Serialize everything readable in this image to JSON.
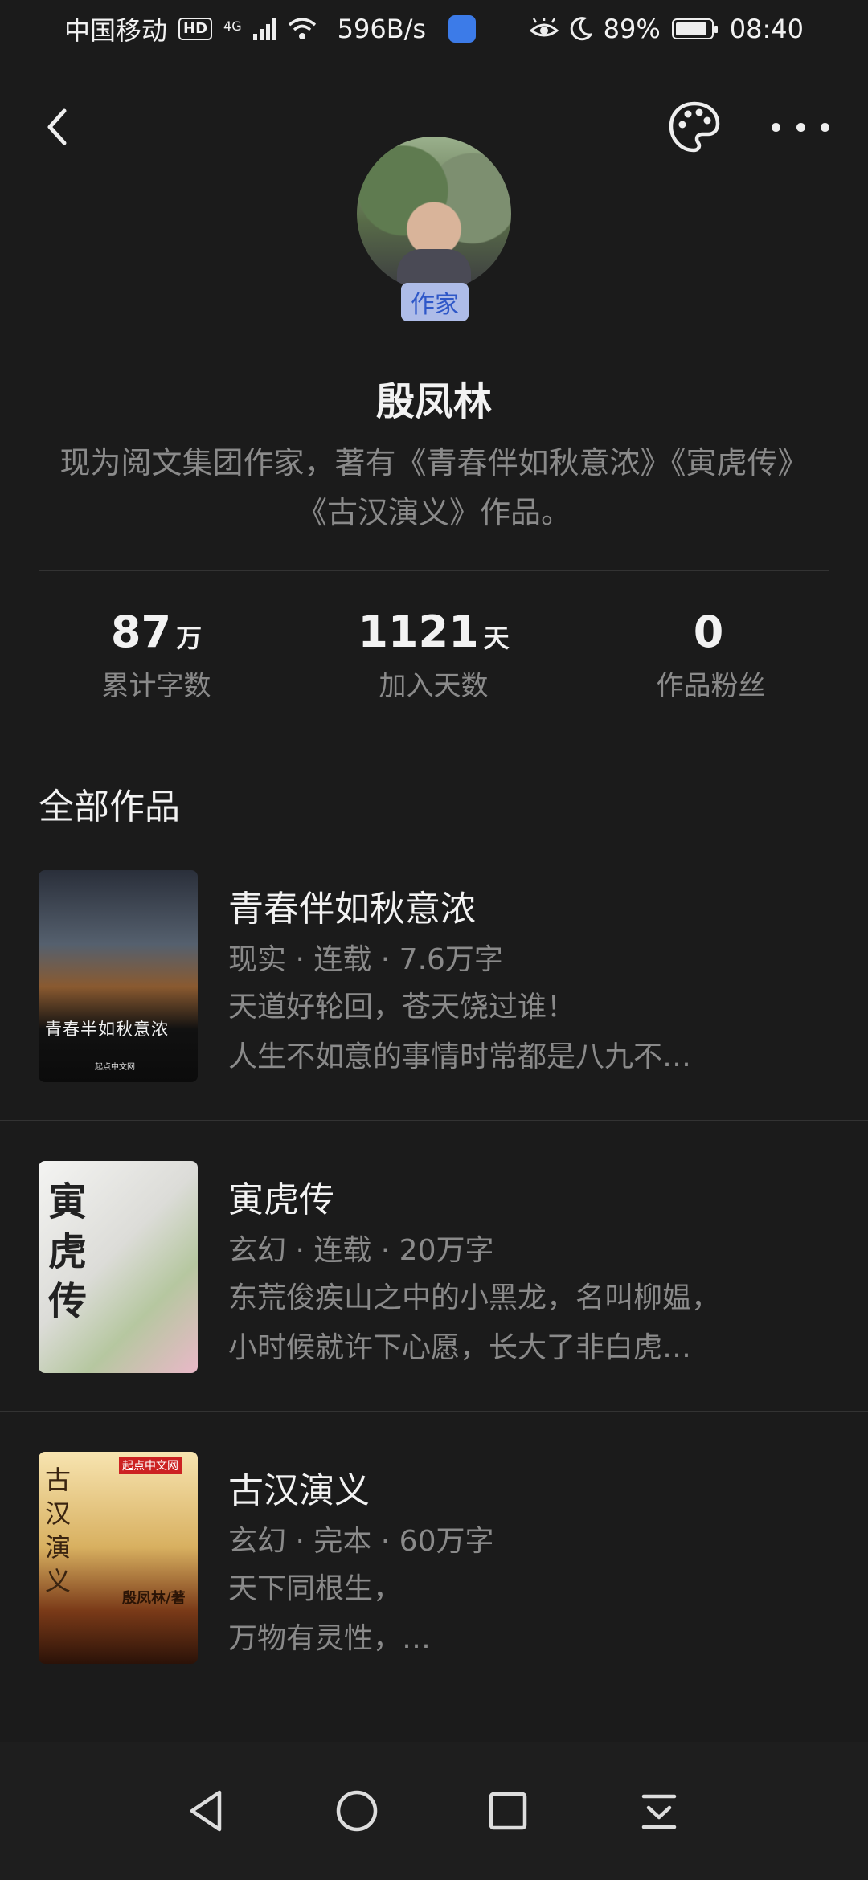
{
  "status_bar": {
    "carrier": "中国移动",
    "hd": "HD",
    "network": "4G",
    "speed": "596B/s",
    "battery": "89%",
    "time": "08:40"
  },
  "header": {
    "back_icon": "chevron-left-icon",
    "palette_icon": "palette-icon",
    "more_icon": "more-dots-icon"
  },
  "profile": {
    "badge": "作家",
    "name": "殷凤林",
    "bio": "现为阅文集团作家，著有《青春伴如秋意浓》《寅虎传》《古汉演义》作品。"
  },
  "stats": [
    {
      "value": "87",
      "unit": "万",
      "label": "累计字数"
    },
    {
      "value": "1121",
      "unit": "天",
      "label": "加入天数"
    },
    {
      "value": "0",
      "unit": "",
      "label": "作品粉丝"
    }
  ],
  "works_title": "全部作品",
  "books": [
    {
      "title": "青春伴如秋意浓",
      "meta": "现实 · 连载 · 7.6万字",
      "desc": "天道好轮回，苍天饶过谁！\n人生不如意的事情时常都是八九不…",
      "cover_text": "青春半如秋意浓",
      "cover_publisher": "起点中文网"
    },
    {
      "title": "寅虎传",
      "meta": "玄幻 · 连载 · 20万字",
      "desc": "东荒俊疾山之中的小黑龙，名叫柳媪，\n小时候就许下心愿，长大了非白虎…",
      "cover_text": "寅虎传"
    },
    {
      "title": "古汉演义",
      "meta": "玄幻 · 完本 · 60万字",
      "desc": "天下同根生，\n 万物有灵性，…",
      "cover_text": "古汉演义",
      "cover_author": "殷凤林/著",
      "cover_publisher": "起点中文网"
    }
  ]
}
